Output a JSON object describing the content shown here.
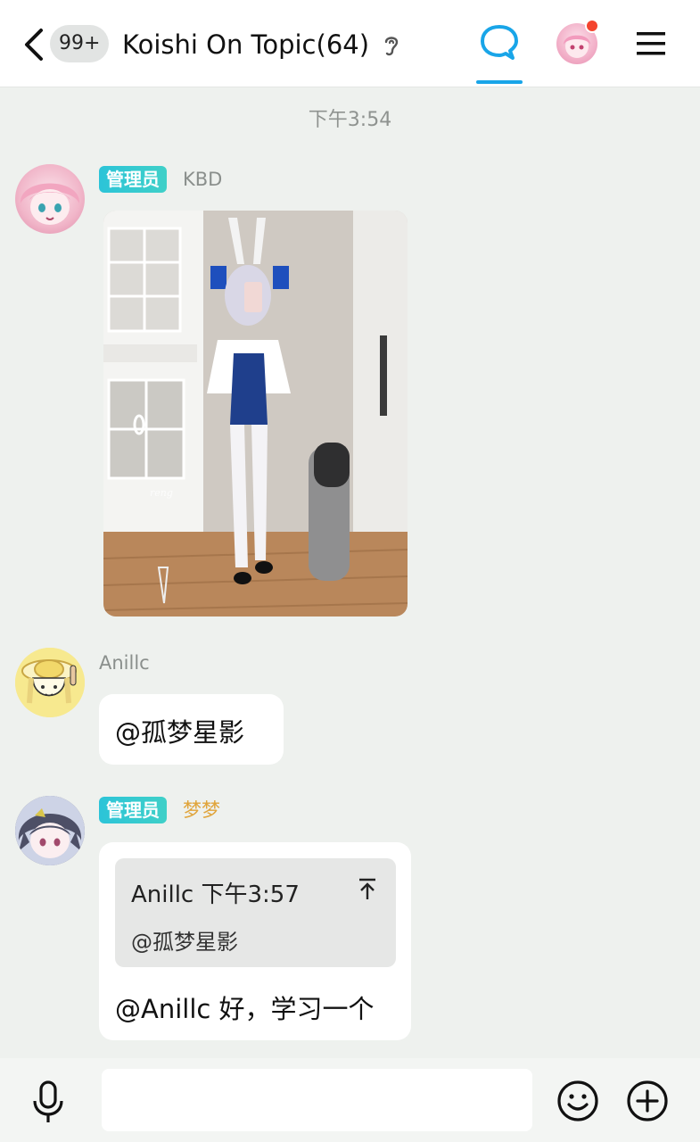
{
  "header": {
    "unread_count": "99+",
    "title": "Koishi On Topic(64)",
    "icons": [
      "back-arrow",
      "ear",
      "chat-bubble",
      "avatar",
      "menu"
    ],
    "accent_color": "#19a5e8",
    "notification_color": "#f4442e"
  },
  "timestamp": "下午3:54",
  "messages": [
    {
      "role": "管理员",
      "name": "KBD",
      "content_type": "image"
    },
    {
      "name": "Anillc",
      "text": "@孤梦星影"
    },
    {
      "role": "管理员",
      "name": "梦梦",
      "reply": {
        "author": "Anillc",
        "time": "下午3:57",
        "text": "@孤梦星影"
      },
      "text": "@Anillc 好，学习一个"
    }
  ],
  "input": {
    "value": "",
    "placeholder": ""
  },
  "role_badge_color": "#2cc4d8",
  "admin_name_color": "#e0a43a"
}
